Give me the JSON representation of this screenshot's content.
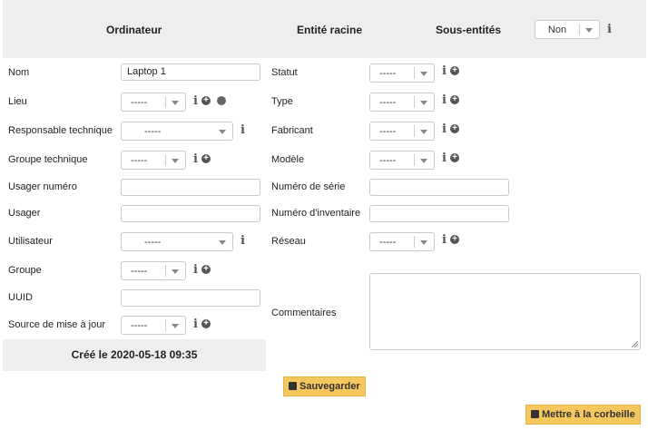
{
  "header": {
    "computer_label": "Ordinateur",
    "root_entity_label": "Entité racine",
    "sub_entities_label": "Sous-entités",
    "sub_entities_value": "Non"
  },
  "form": {
    "name_label": "Nom",
    "name_value": "Laptop 1",
    "location_label": "Lieu",
    "location_value": "-----",
    "tech_manager_label": "Responsable technique",
    "tech_manager_value": "-----",
    "tech_group_label": "Groupe technique",
    "tech_group_value": "-----",
    "user_number_label": "Usager numéro",
    "user_number_value": "",
    "user_label": "Usager",
    "user_value": "",
    "utilisateur_label": "Utilisateur",
    "utilisateur_value": "-----",
    "group_label": "Groupe",
    "group_value": "-----",
    "uuid_label": "UUID",
    "uuid_value": "",
    "update_source_label": "Source de mise à jour",
    "update_source_value": "-----",
    "status_label": "Statut",
    "status_value": "-----",
    "type_label": "Type",
    "type_value": "-----",
    "manufacturer_label": "Fabricant",
    "manufacturer_value": "-----",
    "model_label": "Modèle",
    "model_value": "-----",
    "serial_label": "Numéro de série",
    "serial_value": "",
    "inventory_label": "Numéro d'inventaire",
    "inventory_value": "",
    "network_label": "Réseau",
    "network_value": "-----",
    "comments_label": "Commentaires",
    "comments_value": ""
  },
  "created_text": "Créé le 2020-05-18 09:35",
  "actions": {
    "save_label": "Sauvegarder",
    "trash_label": "Mettre à la corbeille"
  },
  "icons": {
    "info": "info-icon",
    "add": "plus-circle-icon",
    "globe": "globe-icon",
    "save": "floppy-disk-icon",
    "trash": "trash-icon"
  },
  "colors": {
    "header_bg": "#eeeeee",
    "button_bg": "#f5c75e",
    "icon_grey": "#555555"
  }
}
